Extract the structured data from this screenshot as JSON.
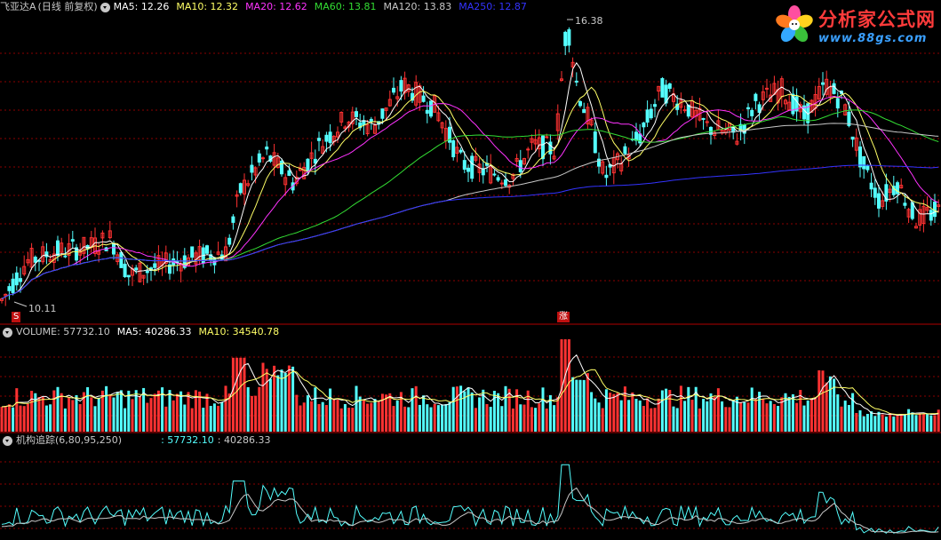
{
  "header": {
    "stock_name": "飞亚达A",
    "period_label": "(日线 前复权)",
    "ma": [
      {
        "label": "MA5: 12.26",
        "color": "#ffffff"
      },
      {
        "label": "MA10: 12.32",
        "color": "#ffff66"
      },
      {
        "label": "MA20: 12.62",
        "color": "#ff33ff"
      },
      {
        "label": "MA60: 13.81",
        "color": "#33dd33"
      },
      {
        "label": "MA120: 13.83",
        "color": "#c8c8c8"
      },
      {
        "label": "MA250: 12.87",
        "color": "#3333ff"
      }
    ]
  },
  "logo": {
    "brand": "分析家公式网",
    "url": "www.88gs.com"
  },
  "price_panel": {
    "high_label": "16.38",
    "low_label": "10.11",
    "mark_s": "S",
    "mark_zhang": "涨"
  },
  "volume_panel": {
    "title": "VOLUME: 57732.10",
    "ma5": "MA5: 40286.33",
    "ma10": "MA10: 34540.78"
  },
  "indicator_panel": {
    "title": "机构追踪(6,80,95,250)",
    "value1": ": 57732.10",
    "value2": ": 40286.33"
  },
  "colors": {
    "up": "#ff3232",
    "down": "#54ffff",
    "grid": "#8b0000",
    "ma5": "#ffffff",
    "ma10": "#ffff66",
    "ma20": "#ff33ff",
    "ma60": "#33dd33",
    "ma120": "#c8c8c8",
    "ma250": "#3333ff"
  },
  "chart_data": {
    "type": "candlestick",
    "price_range": [
      10.11,
      16.38
    ],
    "key_prices": [
      {
        "label": "MA5",
        "value": 12.26
      },
      {
        "label": "MA10",
        "value": 12.32
      },
      {
        "label": "MA20",
        "value": 12.62
      },
      {
        "label": "MA60",
        "value": 13.81
      },
      {
        "label": "MA120",
        "value": 13.83
      },
      {
        "label": "MA250",
        "value": 12.87
      }
    ],
    "volume_last": 57732.1,
    "volume_ma5": 40286.33,
    "volume_ma10": 34540.78
  }
}
